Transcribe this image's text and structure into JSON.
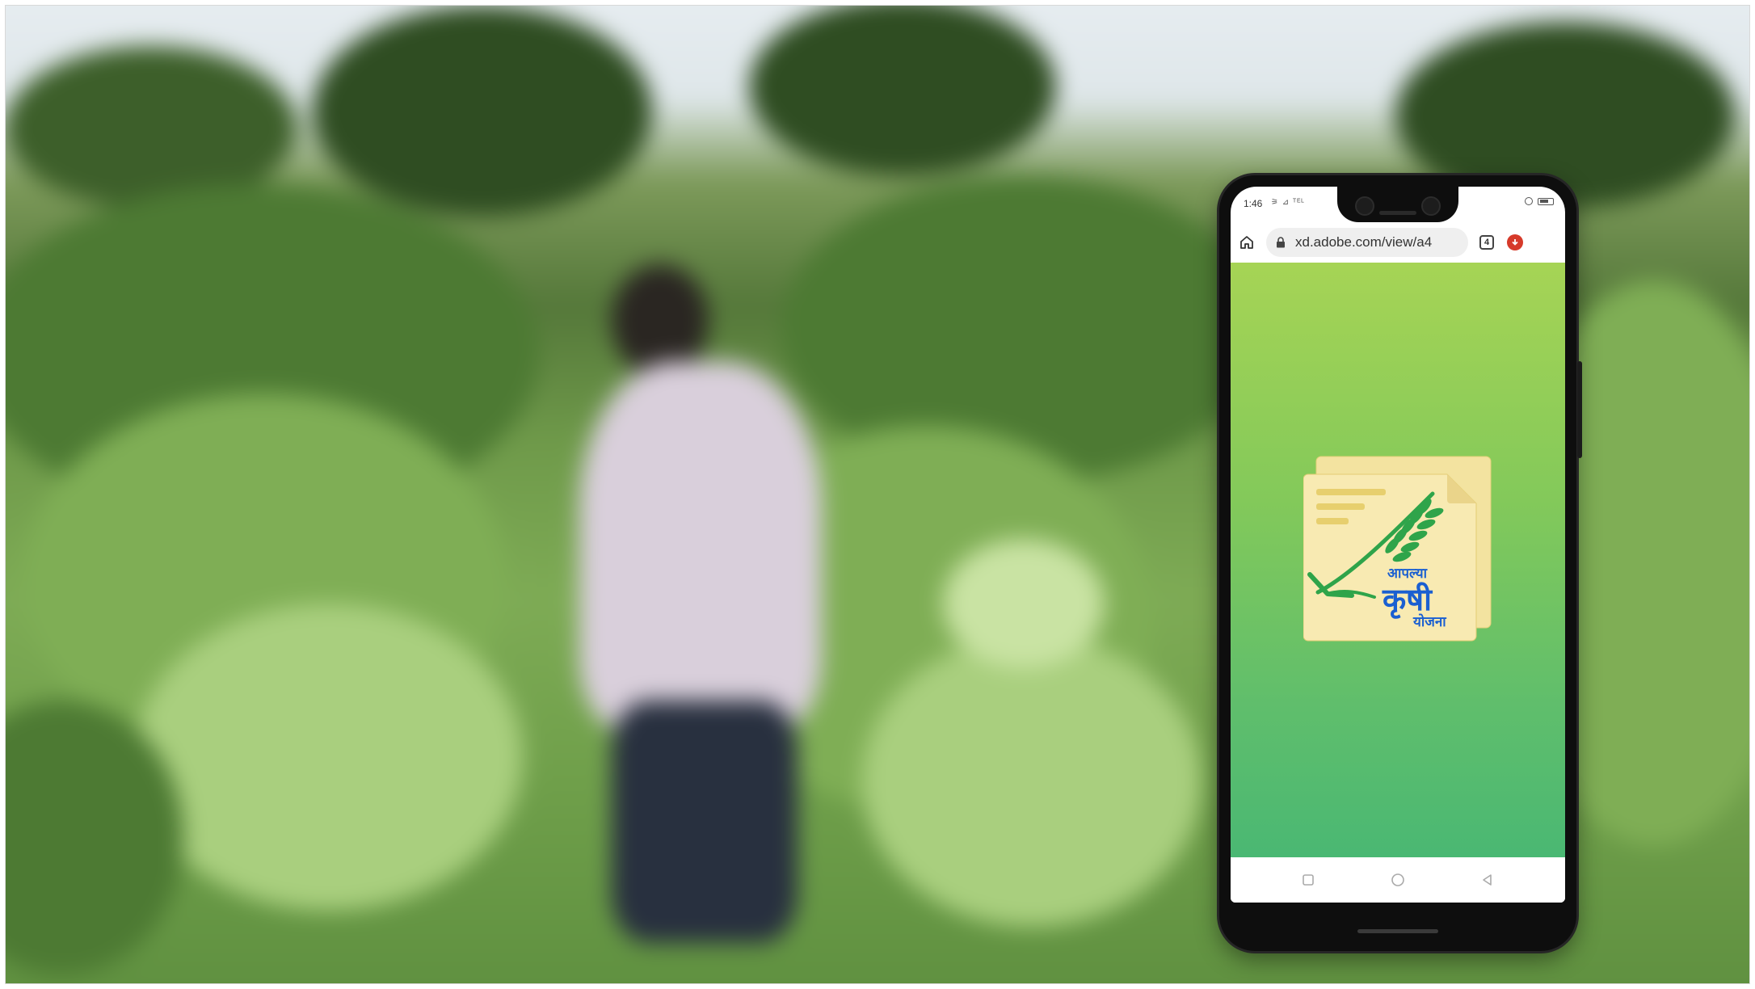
{
  "status_bar": {
    "time": "1:46",
    "network": "⚞ ⊿ ᵀᴱᴸ"
  },
  "browser": {
    "url": "xd.adobe.com/view/a4",
    "tab_count": "4"
  },
  "app_logo": {
    "text_top": "आपल्या",
    "text_main": "कृषी",
    "text_bottom": "योजना"
  },
  "colors": {
    "gradient_top": "#a6d455",
    "gradient_bottom": "#4ab873",
    "logo_text": "#1a5fd1",
    "wheat": "#2fa44a"
  }
}
